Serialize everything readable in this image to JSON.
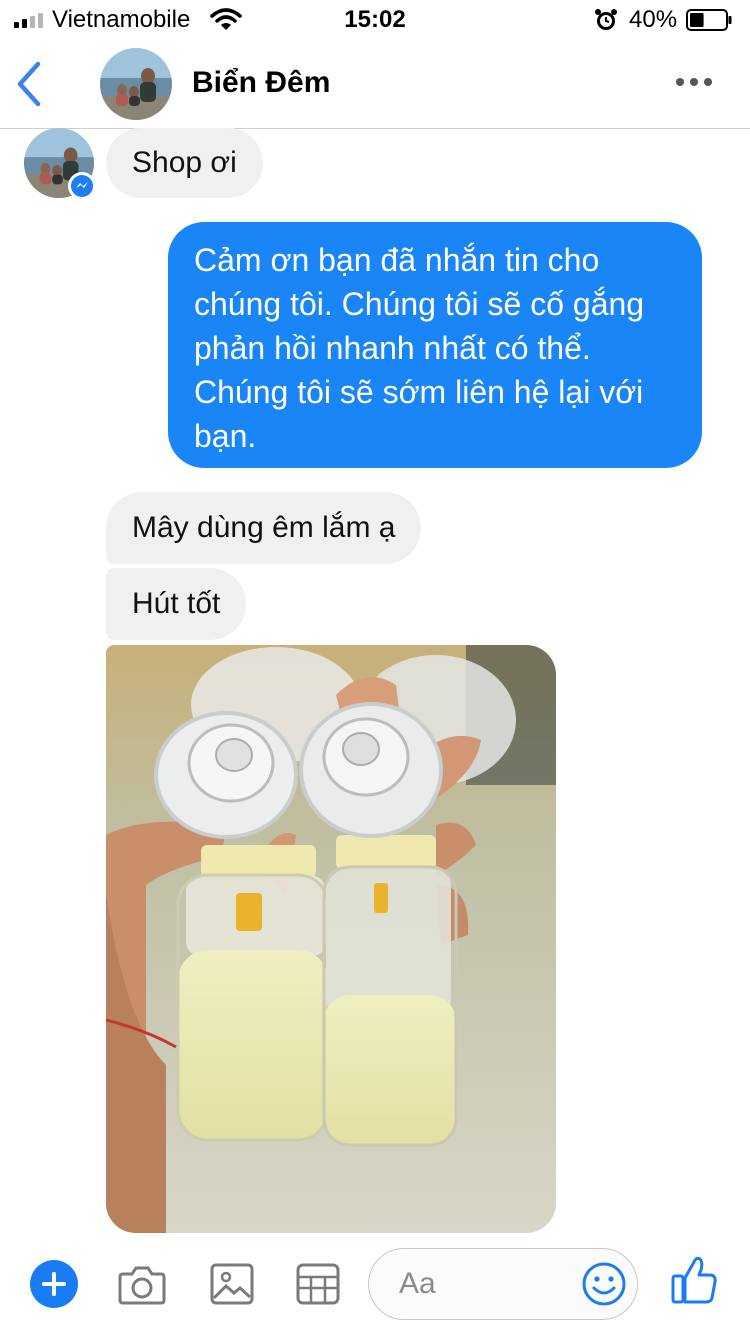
{
  "status_bar": {
    "carrier": "Vietnamobile",
    "time": "15:02",
    "battery_percent": "40%",
    "battery_level": 0.4,
    "signal_bars": 2,
    "icons": [
      "wifi-icon",
      "alarm-icon",
      "battery-icon"
    ]
  },
  "header": {
    "contact_name": "Biển Đêm",
    "icons": [
      "back-arrow-icon",
      "more-icon"
    ]
  },
  "messages": [
    {
      "direction": "incoming",
      "text": "Shop ơi"
    },
    {
      "direction": "outgoing",
      "lines": [
        "Cảm ơn bạn đã nhắn tin cho",
        "chúng tôi. Chúng tôi sẽ cố gắng",
        "phản hồi nhanh nhất có thể.",
        "Chúng tôi sẽ sớm liên hệ lại với",
        "bạn."
      ]
    },
    {
      "direction": "incoming",
      "text": "Mây dùng êm lắm ạ"
    },
    {
      "direction": "incoming",
      "text": "Hút tốt"
    },
    {
      "direction": "incoming",
      "type": "photo"
    }
  ],
  "composer": {
    "placeholder": "Aa",
    "icons": [
      "plus-icon",
      "camera-icon",
      "image-icon",
      "sticker-icon",
      "emoji-icon",
      "thumbs-up-icon"
    ]
  },
  "colors": {
    "accent": "#1a85f6",
    "incoming_bubble": "#f0f0f0",
    "nav_tint": "#3b82f0"
  }
}
